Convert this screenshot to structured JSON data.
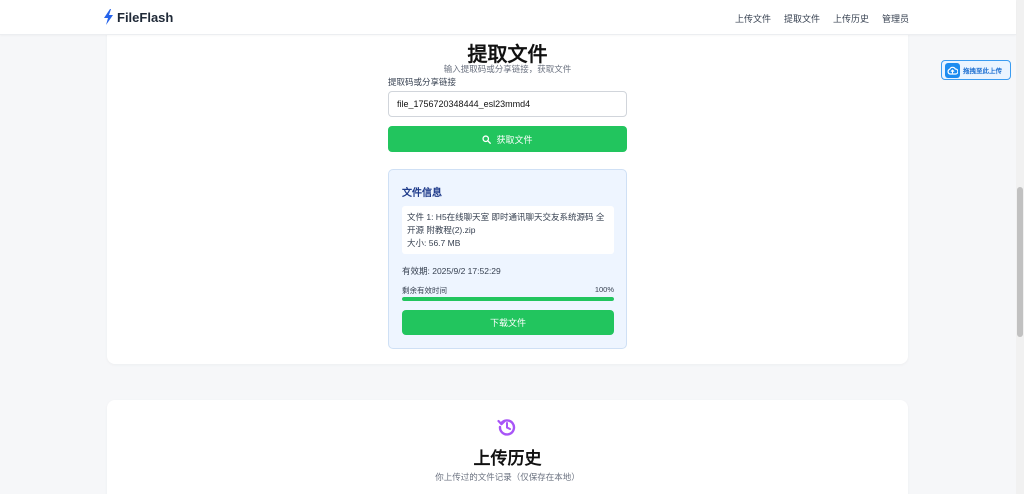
{
  "brand": {
    "name": "FileFlash",
    "accent": "#2563eb"
  },
  "nav": {
    "upload": "上传文件",
    "retrieve": "提取文件",
    "history": "上传历史",
    "admin": "管理员"
  },
  "retrieve": {
    "title": "提取文件",
    "subtitle": "输入提取码或分享链接，获取文件",
    "field_label": "提取码或分享链接",
    "input_value": "file_1756720348444_esl23mmd4",
    "fetch_button": "获取文件",
    "fetch_icon": "search-icon"
  },
  "file_info": {
    "title": "文件信息",
    "file_line": "文件 1: H5在线聊天室 即时通讯聊天交友系统源码 全开源 附教程(2).zip",
    "size_line": "大小: 56.7 MB",
    "expiry": "有效期: 2025/9/2 17:52:29",
    "remaining_label": "剩余有效时间",
    "remaining_percent": "100%",
    "remaining_fraction": 1.0,
    "download_button": "下载文件"
  },
  "history": {
    "icon": "history-icon",
    "title": "上传历史",
    "subtitle": "你上传过的文件记录（仅保存在本地）"
  },
  "drag_upload": {
    "label": "拖拽至此上传",
    "icon": "cloud-upload-icon"
  },
  "colors": {
    "primary_green": "#22c55e",
    "info_bg": "#eef5ff",
    "info_title": "#1e3a8a",
    "history_purple": "#a855f7",
    "badge_blue": "#1d8cf0"
  }
}
